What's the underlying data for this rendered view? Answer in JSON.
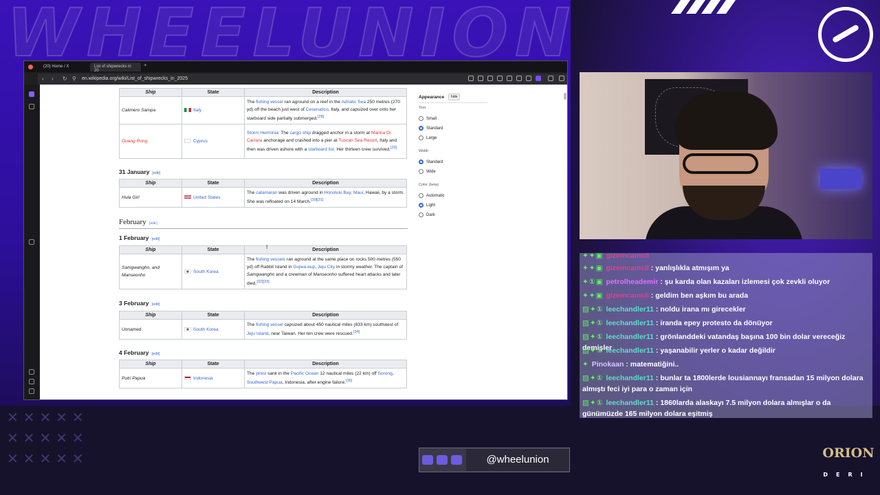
{
  "overlay": {
    "watermark": "WHEELUNION",
    "social_handle": "@wheelunion",
    "sponsor": "ORION",
    "sponsor_sub": "DERI"
  },
  "browser": {
    "tabs": [
      {
        "label": "(20) Home / X"
      },
      {
        "label": "List of shipwrecks in 20"
      }
    ],
    "url": "en.wikipedia.org/wiki/List_of_shipwrecks_in_2025"
  },
  "wiki": {
    "headers": {
      "ship": "Ship",
      "state": "State",
      "description": "Description"
    },
    "edit_label": "edit",
    "table0": [
      {
        "ship": "Calimero Sampa",
        "state": "Italy",
        "desc_parts": [
          "The ",
          "fishing vessel",
          " ran aground on a reef in the ",
          "Adriatic Sea",
          " 250 metres (270 yd) off the beach just west of ",
          "Cesenatico",
          ", Italy, and capsized over onto her starboard side partially submerged.",
          "[28]"
        ]
      },
      {
        "ship": "Guang Rong",
        "state": "Cyprus",
        "desc_parts": [
          "Storm Herminia",
          ": The ",
          "cargo ship",
          " dragged anchor in a storm at ",
          "Marina Di Carrara",
          " anchorage and crashed into a pier at ",
          "Tuscan Sea Resort",
          ", Italy and then was driven ashore with a ",
          "starboard list",
          ". Her thirteen crew survived.",
          "[29]"
        ]
      }
    ],
    "sections": [
      {
        "title": "31 January",
        "rows": [
          {
            "ship": "Hula Girl",
            "state": "United States",
            "desc_parts": [
              "The ",
              "catamaran",
              " was driven aground in ",
              "Honolulu Bay, Maui",
              ", Hawaii, by a storm. She was refloated on 14 March.",
              "[30][31]"
            ]
          }
        ]
      },
      {
        "title": "February"
      },
      {
        "title": "1 February",
        "rows": [
          {
            "ship": "Samgwangho, and Manseonho",
            "state": "South Korea",
            "desc_parts": [
              "The ",
              "fishing vessels",
              " ran aground at the same place on rocks 500 metres (550 yd) off Rabbit Island in ",
              "Gujwa-eup",
              ", ",
              "Jeju City",
              " in stormy weather. The captain of ",
              "Samgwangho",
              " and a crewman of ",
              "Manseonho",
              " suffered heart attacks and later died.",
              "[32][33]"
            ]
          }
        ]
      },
      {
        "title": "3 February",
        "rows": [
          {
            "ship": "Unnamed",
            "state": "South Korea",
            "desc_parts": [
              "The ",
              "fishing vessel",
              " capsized about 450 nautical miles (833 km) southwest of ",
              "Jeju Island",
              ", near Taiwan. Her ten crew were rescued.",
              "[34]"
            ]
          }
        ]
      },
      {
        "title": "4 February",
        "rows": [
          {
            "ship": "Putri Papua",
            "state": "Indonesia",
            "desc_parts": [
              "The ",
              "pinisi",
              " sank in the ",
              "Pacific Ocean",
              " 12 nautical miles (22 km) off ",
              "Sorong",
              ", ",
              "Southwest Papua",
              ", Indonesia, after engine failure.",
              "[35]"
            ]
          }
        ]
      }
    ],
    "appearance": {
      "title": "Appearance",
      "hide": "hide",
      "text_label": "Text",
      "text_options": [
        "Small",
        "Standard",
        "Large"
      ],
      "text_selected": "Standard",
      "width_label": "Width",
      "width_options": [
        "Standard",
        "Wide"
      ],
      "width_selected": "Standard",
      "color_label": "Color (beta)",
      "color_options": [
        "Automatic",
        "Light",
        "Dark"
      ],
      "color_selected": "Light"
    }
  },
  "chat": [
    {
      "user": "gizemcamcil",
      "msg": "",
      "color": "#e0408a"
    },
    {
      "user": "gizemcamcil",
      "msg": "yanlışlıkla atmışım ya",
      "color": "#e0408a"
    },
    {
      "user": "petrolheademir",
      "msg": "şu karda olan kazaları izlemesi çok zevkli oluyor",
      "color": "#e070ff"
    },
    {
      "user": "gizemcamcil",
      "msg": "geldim ben aşkım bu arada",
      "color": "#e0408a"
    },
    {
      "user": "leechandler11",
      "msg": "noldu irana mı girecekler",
      "color": "#5ee0c8"
    },
    {
      "user": "leechandler11",
      "msg": "iranda epey protesto da dönüyor",
      "color": "#5ee0c8"
    },
    {
      "user": "leechandler11",
      "msg": "grönlanddeki vatandaş başına 100 bin dolar vereceğiz demişler",
      "color": "#5ee0c8"
    },
    {
      "user": "leechandler11",
      "msg": "yaşanabilir yerler o kadar değildir",
      "color": "#5ee0c8"
    },
    {
      "user": "Pinokaan",
      "msg": "matematiğini..",
      "color": "#d9c3ff"
    },
    {
      "user": "leechandler11",
      "msg": "bunlar ta 1800lerde lousiannayı fransadan 15 milyon dolara almıştı feci iyi para o zaman için",
      "color": "#5ee0c8"
    },
    {
      "user": "leechandler11",
      "msg": "1860larda alaskayı 7.5 milyon dolara almışlar o da günümüzde 165 milyon dolara eşitmiş",
      "color": "#5ee0c8"
    }
  ]
}
